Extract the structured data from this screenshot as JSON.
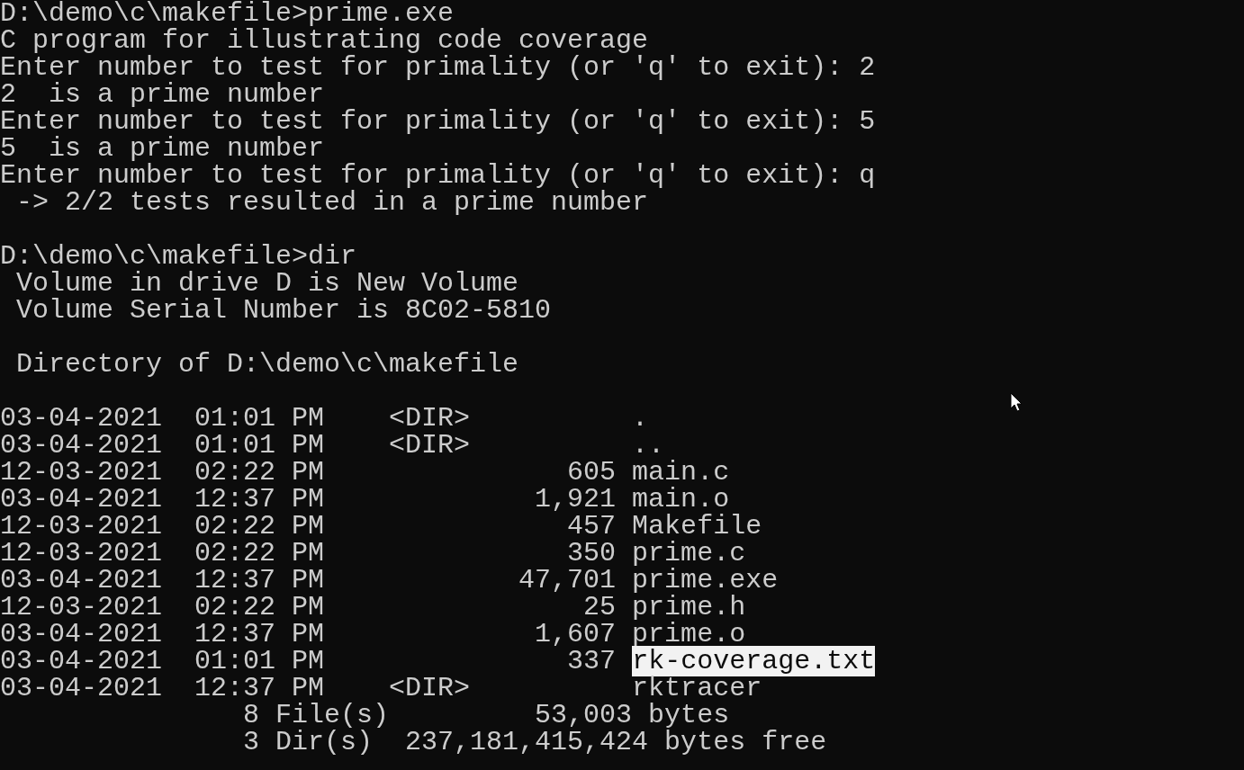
{
  "console": {
    "lines": [
      {
        "kind": "text",
        "text": "D:\\demo\\c\\makefile>prime.exe"
      },
      {
        "kind": "text",
        "text": "C program for illustrating code coverage"
      },
      {
        "kind": "text",
        "text": "Enter number to test for primality (or 'q' to exit): 2"
      },
      {
        "kind": "text",
        "text": "2  is a prime number"
      },
      {
        "kind": "text",
        "text": "Enter number to test for primality (or 'q' to exit): 5"
      },
      {
        "kind": "text",
        "text": "5  is a prime number"
      },
      {
        "kind": "text",
        "text": "Enter number to test for primality (or 'q' to exit): q"
      },
      {
        "kind": "text",
        "text": " -> 2/2 tests resulted in a prime number"
      },
      {
        "kind": "blank"
      },
      {
        "kind": "text",
        "text": "D:\\demo\\c\\makefile>dir"
      },
      {
        "kind": "text",
        "text": " Volume in drive D is New Volume"
      },
      {
        "kind": "text",
        "text": " Volume Serial Number is 8C02-5810"
      },
      {
        "kind": "blank"
      },
      {
        "kind": "text",
        "text": " Directory of D:\\demo\\c\\makefile"
      },
      {
        "kind": "blank"
      },
      {
        "kind": "text",
        "text": "03-04-2021  01:01 PM    <DIR>          ."
      },
      {
        "kind": "text",
        "text": "03-04-2021  01:01 PM    <DIR>          .."
      },
      {
        "kind": "text",
        "text": "12-03-2021  02:22 PM               605 main.c"
      },
      {
        "kind": "text",
        "text": "03-04-2021  12:37 PM             1,921 main.o"
      },
      {
        "kind": "text",
        "text": "12-03-2021  02:22 PM               457 Makefile"
      },
      {
        "kind": "text",
        "text": "12-03-2021  02:22 PM               350 prime.c"
      },
      {
        "kind": "text",
        "text": "03-04-2021  12:37 PM            47,701 prime.exe"
      },
      {
        "kind": "text",
        "text": "12-03-2021  02:22 PM                25 prime.h"
      },
      {
        "kind": "text",
        "text": "03-04-2021  12:37 PM             1,607 prime.o"
      },
      {
        "kind": "selected",
        "text": "03-04-2021  01:01 PM               337 ",
        "selection": "rk-coverage.txt"
      },
      {
        "kind": "text",
        "text": "03-04-2021  12:37 PM    <DIR>          rktracer"
      },
      {
        "kind": "text",
        "text": "               8 File(s)         53,003 bytes"
      },
      {
        "kind": "text",
        "text": "               3 Dir(s)  237,181,415,424 bytes free"
      }
    ]
  }
}
